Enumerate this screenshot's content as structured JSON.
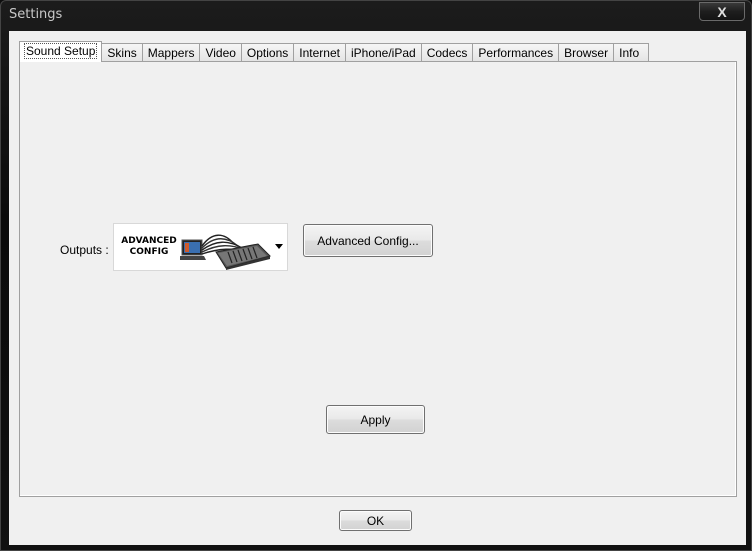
{
  "window": {
    "title": "Settings",
    "close_label": "X"
  },
  "tabs": [
    {
      "label": "Sound Setup",
      "active": true
    },
    {
      "label": "Skins"
    },
    {
      "label": "Mappers"
    },
    {
      "label": "Video"
    },
    {
      "label": "Options"
    },
    {
      "label": "Internet"
    },
    {
      "label": "iPhone/iPad"
    },
    {
      "label": "Codecs"
    },
    {
      "label": "Performances"
    },
    {
      "label": "Browser"
    },
    {
      "label": "Info"
    }
  ],
  "sound_setup": {
    "outputs_label": "Outputs :",
    "outputs_selected": {
      "line1": "ADVANCED",
      "line2": "CONFIG",
      "icon": "laptop-mixer-icon"
    },
    "advanced_config_label": "Advanced Config...",
    "apply_label": "Apply"
  },
  "footer": {
    "ok_label": "OK"
  }
}
